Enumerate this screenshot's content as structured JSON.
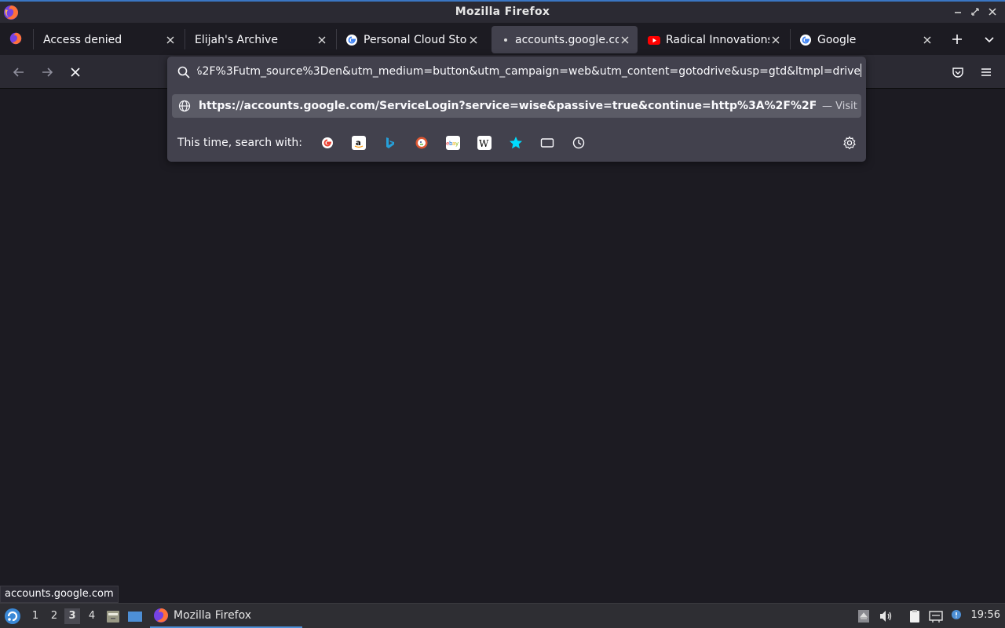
{
  "window": {
    "title": "Mozilla Firefox"
  },
  "tabs": [
    {
      "label": "Access denied",
      "favicon": "firefox-icon"
    },
    {
      "label": "Elijah's Archive",
      "favicon": ""
    },
    {
      "label": "Personal Cloud Storage",
      "favicon": "google-icon"
    },
    {
      "label": "accounts.google.com",
      "favicon": "loading-dot-icon"
    },
    {
      "label": "Radical Innovations",
      "favicon": "youtube-icon"
    },
    {
      "label": "Google",
      "favicon": "google-icon"
    }
  ],
  "urlbar": {
    "value": "%2F%3Futm_source%3Den&utm_medium=button&utm_campaign=web&utm_content=gotodrive&usp=gtd&ltmpl=drive",
    "result_url": "https://accounts.google.com/ServiceLogin?service=wise&passive=true&continue=http%3A%2F%2F",
    "result_action": "— Visit",
    "search_with_label": "This time, search with:",
    "engines": [
      "google-icon",
      "amazon-icon",
      "bing-icon",
      "duckduckgo-icon",
      "ebay-icon",
      "wikipedia-icon",
      "bookmarks-star-icon",
      "tabs-icon",
      "history-icon"
    ]
  },
  "status_link": "accounts.google.com",
  "taskbar": {
    "workspaces": [
      "1",
      "2",
      "3",
      "4"
    ],
    "active_workspace": "3",
    "task_label": "Mozilla Firefox",
    "clock": "19:56"
  },
  "colors": {
    "accent": "#3a76c4",
    "background": "#1c1b22",
    "toolbar": "#2b2a33"
  }
}
